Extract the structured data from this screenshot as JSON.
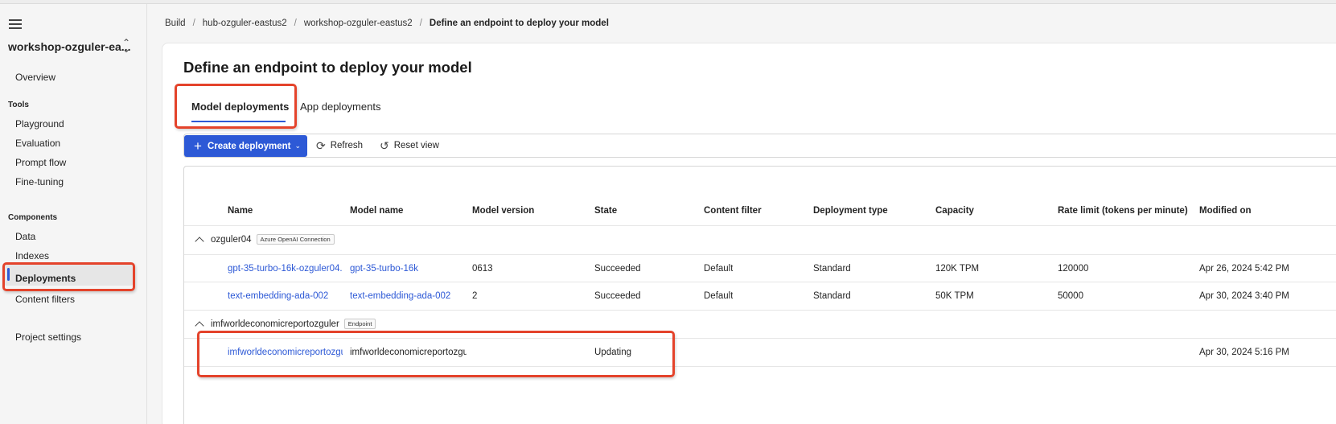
{
  "sidebar": {
    "project_name": "workshop-ozguler-ea...",
    "overview": "Overview",
    "tools_heading": "Tools",
    "tools": [
      "Playground",
      "Evaluation",
      "Prompt flow",
      "Fine-tuning"
    ],
    "components_heading": "Components",
    "components": [
      "Data",
      "Indexes",
      "Deployments",
      "Content filters"
    ],
    "active_item": "Deployments",
    "project_settings": "Project settings"
  },
  "breadcrumb": [
    "Build",
    "hub-ozguler-eastus2",
    "workshop-ozguler-eastus2",
    "Define an endpoint to deploy your model"
  ],
  "page": {
    "title": "Define an endpoint to deploy your model",
    "tabs": [
      "Model deployments",
      "App deployments"
    ],
    "active_tab": "Model deployments"
  },
  "toolbar": {
    "create_label": "Create deployment",
    "refresh_label": "Refresh",
    "reset_label": "Reset view"
  },
  "table": {
    "columns": [
      "Name",
      "Model name",
      "Model version",
      "State",
      "Content filter",
      "Deployment type",
      "Capacity",
      "Rate limit (tokens per minute)",
      "Modified on"
    ],
    "groups": [
      {
        "name": "ozguler04",
        "badge": "Azure OpenAI Connection",
        "rows": [
          [
            "gpt-35-turbo-16k-ozguler04.",
            "gpt-35-turbo-16k",
            "0613",
            "Succeeded",
            "Default",
            "Standard",
            "120K TPM",
            "120000",
            "Apr 26, 2024 5:42 PM"
          ],
          [
            "text-embedding-ada-002",
            "text-embedding-ada-002",
            "2",
            "Succeeded",
            "Default",
            "Standard",
            "50K TPM",
            "50000",
            "Apr 30, 2024 3:40 PM"
          ]
        ]
      },
      {
        "name": "imfworldeconomicreportozguler",
        "badge": "Endpoint",
        "rows": [
          [
            "imfworldeconomicreportozguler",
            "imfworldeconomicreportozguler",
            "",
            "Updating",
            "",
            "",
            "",
            "",
            "Apr 30, 2024 5:16 PM"
          ]
        ]
      }
    ]
  },
  "colors": {
    "accent": "#2d59d6",
    "highlight": "#e4432b"
  },
  "icons": {
    "menu": "hamburger-icon",
    "switch": "chevron-updown-icon",
    "add": "plus-icon",
    "refresh": "refresh-icon",
    "reset": "reset-icon"
  }
}
